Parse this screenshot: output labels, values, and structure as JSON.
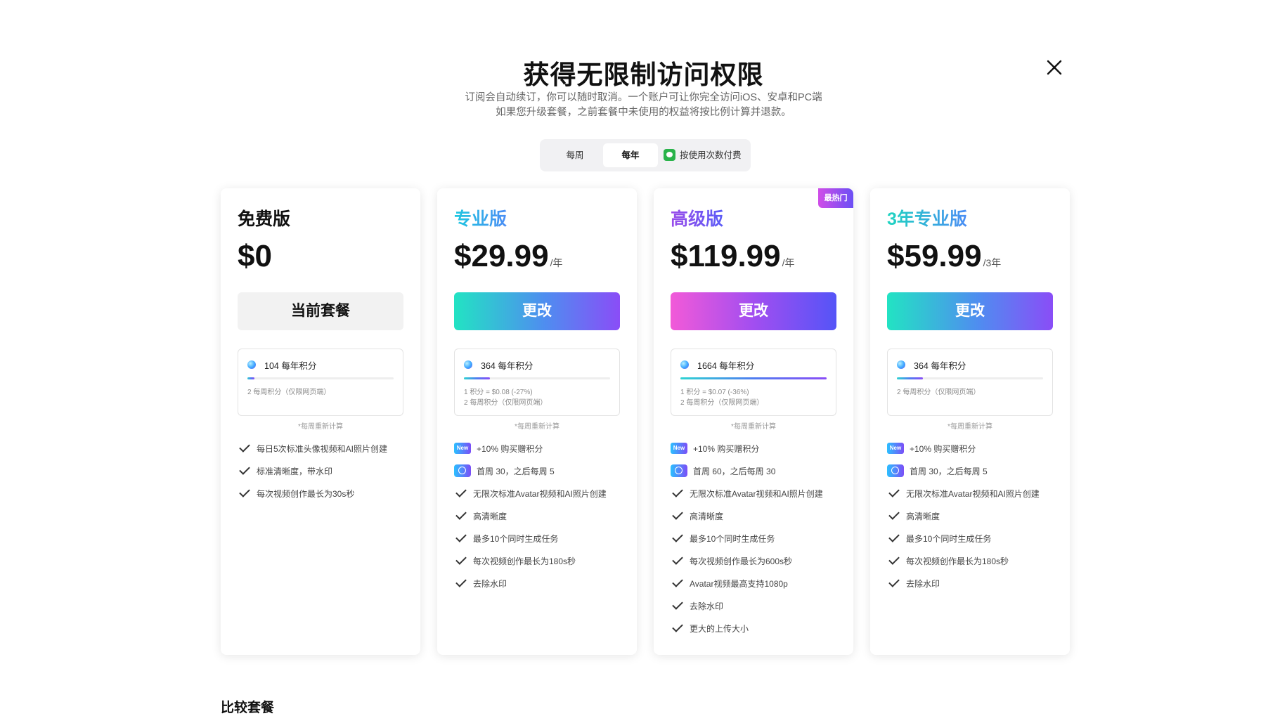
{
  "header": {
    "title": "获得无限制访问权限",
    "subtitle_line1": "订阅会自动续订，你可以随时取消。一个账户可让你完全访问iOS、安卓和PC端",
    "subtitle_line2": "如果您升级套餐，之前套餐中未使用的权益将按比例计算并退款。"
  },
  "billing_toggle": {
    "options": [
      "每周",
      "每年",
      "按使用次数付费"
    ],
    "selected": "每年"
  },
  "plans": [
    {
      "name": "免费版",
      "price": "$0",
      "period": "",
      "cta": "当前套餐",
      "credits_title": "104 每年积分",
      "credits_fill": 0.05,
      "credit_notes": [
        "2 每周积分（仅限网页端）"
      ],
      "weekly_note": "*每周重新计算",
      "features": [
        "每日5次标准头像视频和AI照片创建",
        "标准清晰度，带水印",
        "每次视频创作最长为30s秒"
      ]
    },
    {
      "name": "专业版",
      "price": "$29.99",
      "period": "/年",
      "cta": "更改",
      "credits_title": "364 每年积分",
      "credits_fill": 0.18,
      "credit_notes": [
        "1 积分 = $0.08 (-27%)",
        "2 每周积分（仅限网页端）"
      ],
      "weekly_note": "*每周重新计算",
      "new_feature": "+10% 购买赠积分",
      "clock_feature": "首周 30，之后每周 5",
      "features": [
        "无限次标准Avatar视频和AI照片创建",
        "高清晰度",
        "最多10个同时生成任务",
        "每次视频创作最长为180s秒",
        "去除水印"
      ]
    },
    {
      "name": "高级版",
      "price": "$119.99",
      "period": "/年",
      "cta": "更改",
      "badge": "最热门",
      "credits_title": "1664 每年积分",
      "credits_fill": 1.0,
      "credit_notes": [
        "1 积分 = $0.07 (-36%)",
        "2 每周积分（仅限网页端）"
      ],
      "weekly_note": "*每周重新计算",
      "new_feature": "+10% 购买赠积分",
      "clock_feature": "首周 60，之后每周 30",
      "features": [
        "无限次标准Avatar视频和AI照片创建",
        "高清晰度",
        "最多10个同时生成任务",
        "每次视频创作最长为600s秒",
        "Avatar视频最高支持1080p",
        "去除水印",
        "更大的上传大小"
      ]
    },
    {
      "name": "3年专业版",
      "price": "$59.99",
      "period": "/3年",
      "cta": "更改",
      "credits_title": "364 每年积分",
      "credits_fill": 0.18,
      "credit_notes": [
        "2 每周积分（仅限网页端）"
      ],
      "weekly_note": "*每周重新计算",
      "new_feature": "+10% 购买赠积分",
      "clock_feature": "首周 30，之后每周 5",
      "features": [
        "无限次标准Avatar视频和AI照片创建",
        "高清晰度",
        "最多10个同时生成任务",
        "每次视频创作最长为180s秒",
        "去除水印"
      ]
    }
  ],
  "new_badge_label": "New",
  "compare_title": "比较套餐",
  "icons": {
    "close": "close-icon",
    "wechat": "wechat-pay-icon",
    "credit": "credit-coin-icon",
    "check": "check-icon",
    "clock": "clock-icon"
  }
}
